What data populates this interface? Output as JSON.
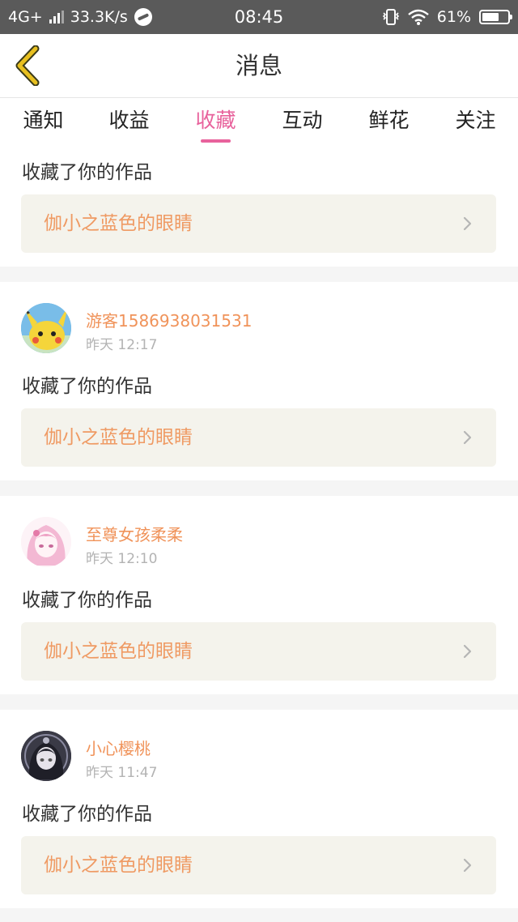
{
  "status_bar": {
    "network": "4G+",
    "speed": "33.3K/s",
    "time": "08:45",
    "battery": "61%"
  },
  "header": {
    "title": "消息"
  },
  "tabs": [
    {
      "label": "通知"
    },
    {
      "label": "收益"
    },
    {
      "label": "收藏",
      "active": true
    },
    {
      "label": "互动"
    },
    {
      "label": "鲜花"
    },
    {
      "label": "关注"
    }
  ],
  "items": [
    {
      "user": "",
      "time": "",
      "action": "收藏了你的作品",
      "work": "伽小之蓝色的眼睛"
    },
    {
      "user": "游客1586938031531",
      "time": "昨天 12:17",
      "action": "收藏了你的作品",
      "work": "伽小之蓝色的眼睛",
      "avatar": "pikachu-avatar"
    },
    {
      "user": "至尊女孩柔柔",
      "time": "昨天 12:10",
      "action": "收藏了你的作品",
      "work": "伽小之蓝色的眼睛",
      "avatar": "pink-anime-girl-avatar"
    },
    {
      "user": "小心樱桃",
      "time": "昨天 11:47",
      "action": "收藏了你的作品",
      "work": "伽小之蓝色的眼睛",
      "avatar": "dark-anime-girl-avatar"
    }
  ],
  "colors": {
    "accent": "#e8629c",
    "username": "#f0935a",
    "work_title": "#ef9a63",
    "back_icon": "#e8c020"
  }
}
